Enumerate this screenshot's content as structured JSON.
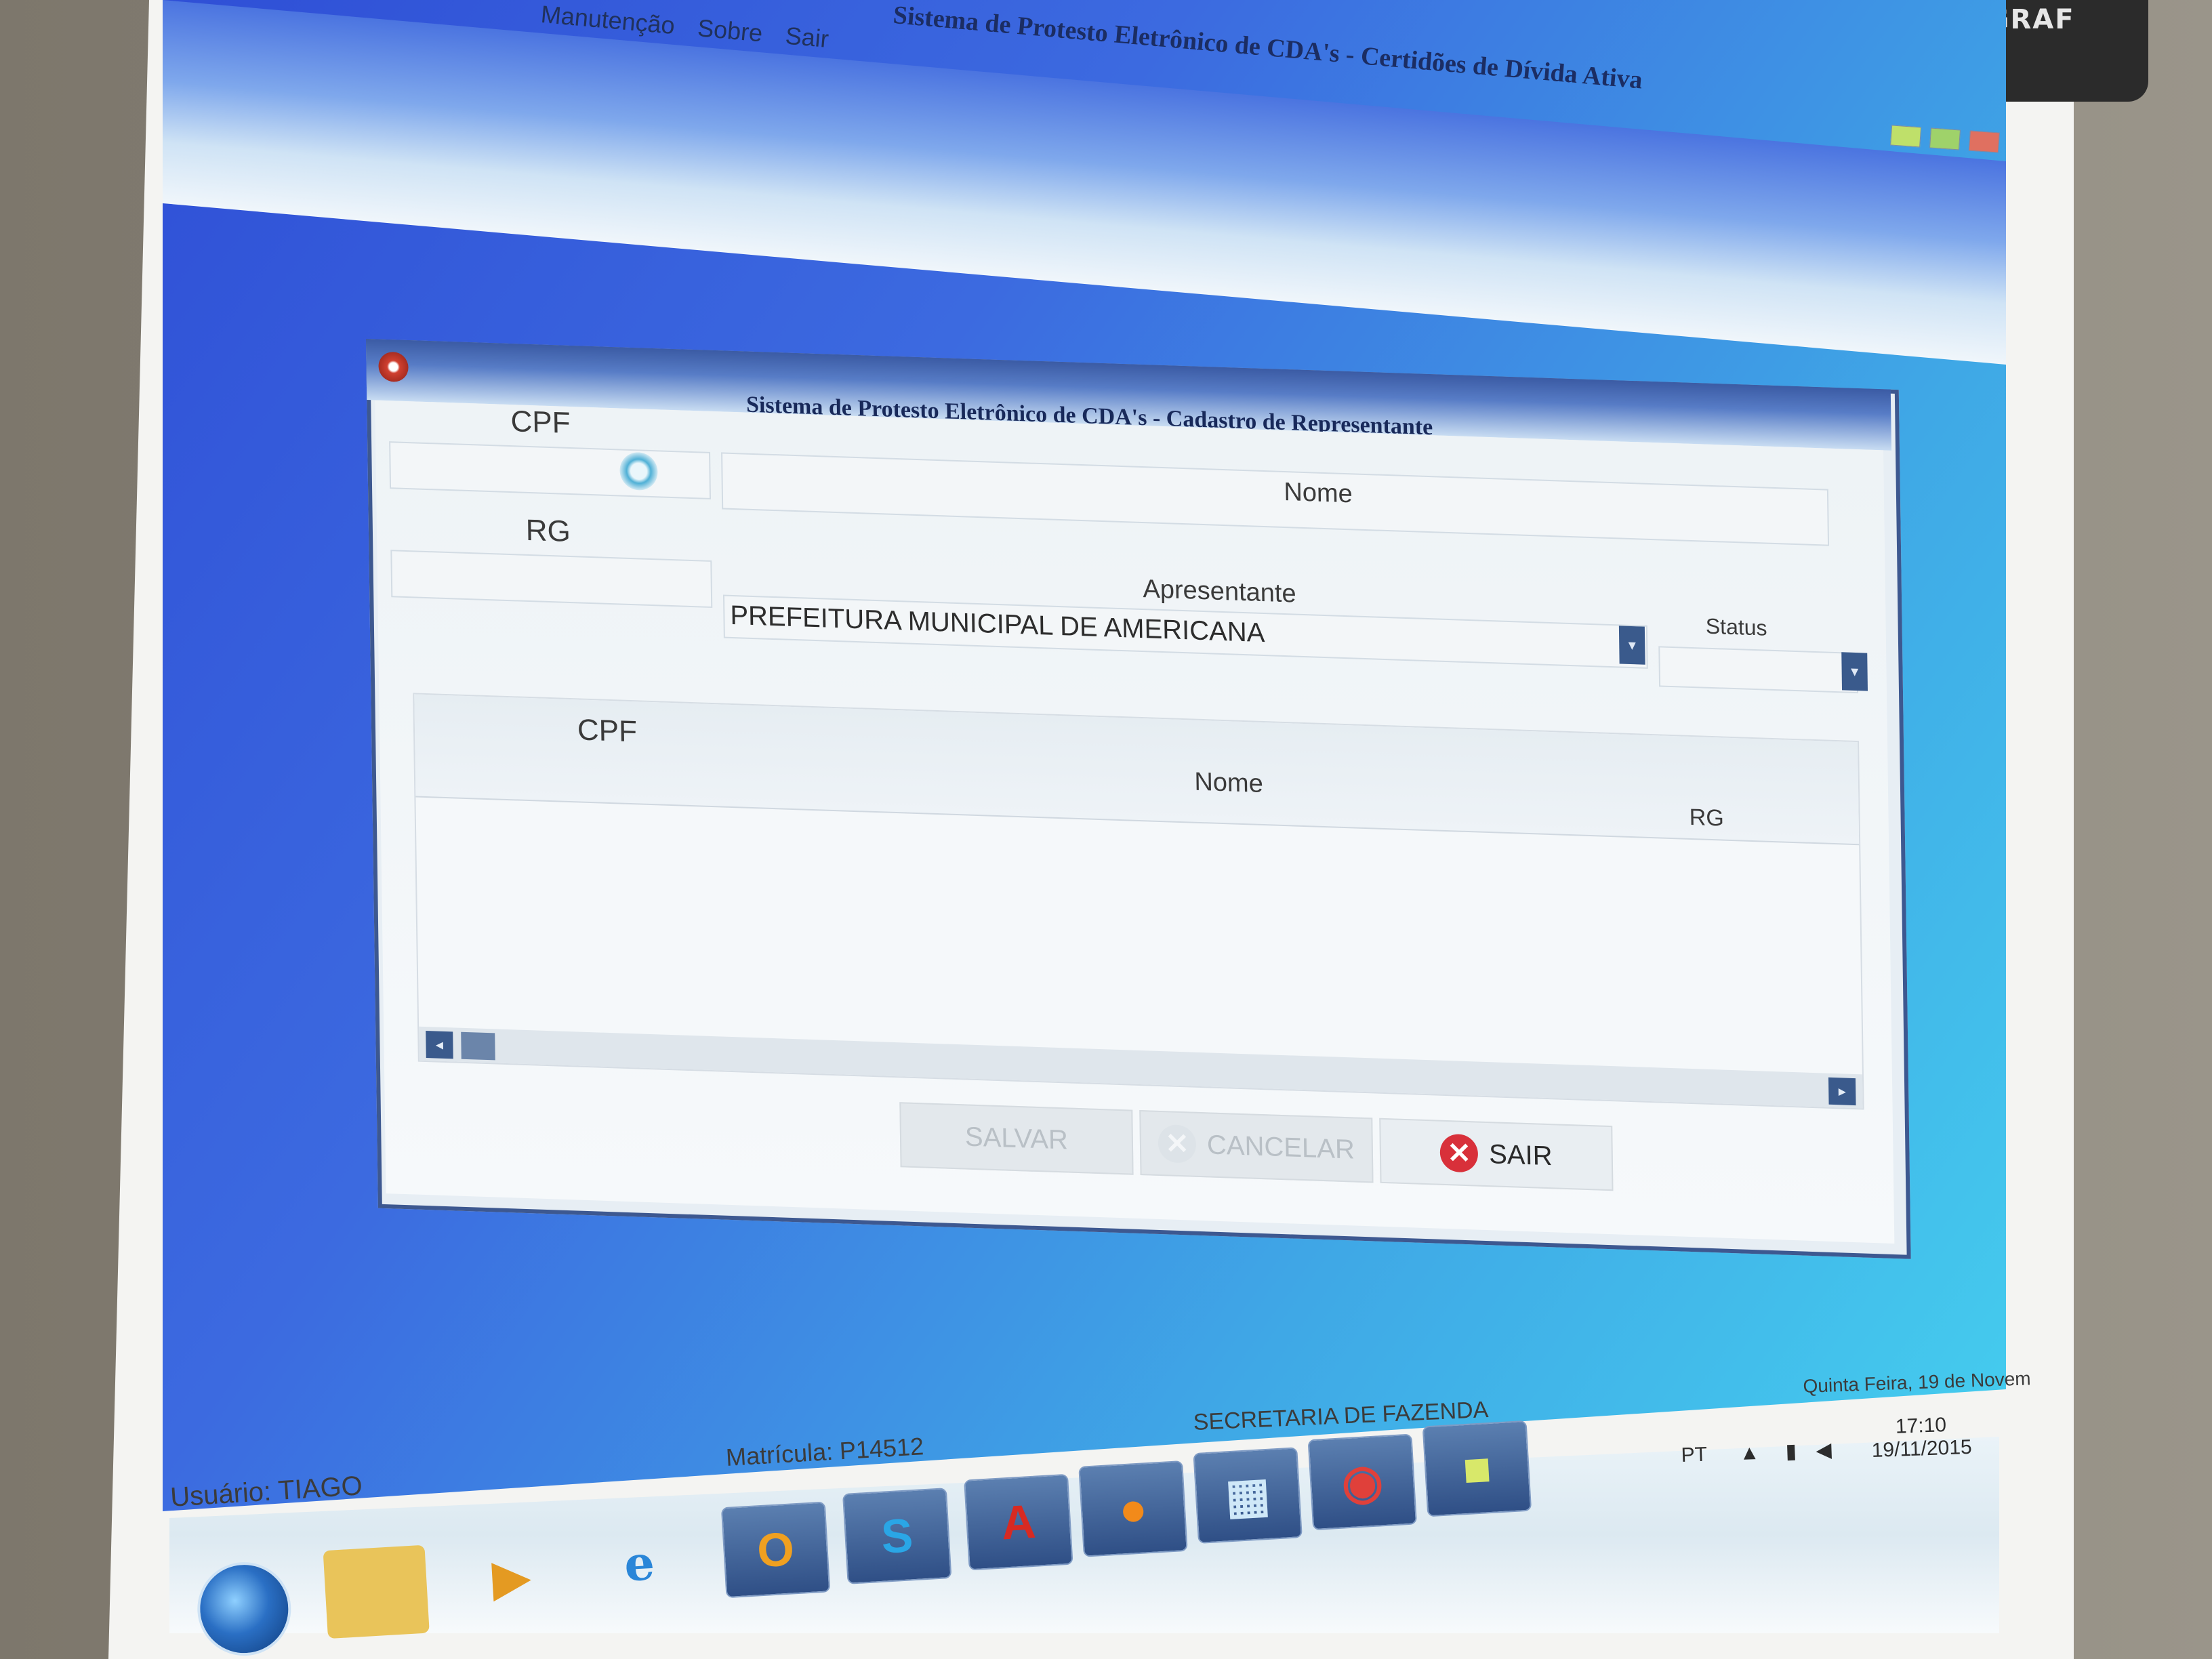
{
  "projector": {
    "brand": "VISOGRAF"
  },
  "main_window": {
    "title": "Sistema de Protesto Eletrônico de CDA's - Certidões de Dívida Ativa",
    "menu": [
      "Manutenção",
      "Sobre",
      "Sair"
    ]
  },
  "dialog": {
    "title": "Sistema de Protesto Eletrônico de CDA's - Cadastro de Representante",
    "fields": {
      "cpf_label": "CPF",
      "cpf_value": "",
      "nome_label": "Nome",
      "nome_value": "",
      "rg_label": "RG",
      "rg_value": "",
      "apresentante_label": "Apresentante",
      "apresentante_value": "PREFEITURA MUNICIPAL DE AMERICANA",
      "status_label": "Status",
      "status_value": ""
    },
    "grid": {
      "columns": [
        "CPF",
        "Nome",
        "RG"
      ],
      "rows": []
    },
    "buttons": {
      "save": "SALVAR",
      "cancel": "CANCELAR",
      "exit": "SAIR"
    }
  },
  "status_bar": {
    "user": "Usuário: TIAGO",
    "registration": "Matrícula: P14512",
    "department": "SECRETARIA DE FAZENDA",
    "date_long": "Quinta Feira, 19 de Novem"
  },
  "taskbar": {
    "language": "PT",
    "time": "17:10",
    "date": "19/11/2015",
    "apps": [
      "file-explorer",
      "media-player",
      "internet-explorer",
      "outlook",
      "skype",
      "adobe-reader",
      "firefox",
      "remote-desktop",
      "app-red",
      "sticky-notes"
    ]
  },
  "colors": {
    "desktop_start": "#2f4fd6",
    "desktop_end": "#45d0ef",
    "window_frame": "#3d5890",
    "exit_icon": "#d8303a"
  }
}
